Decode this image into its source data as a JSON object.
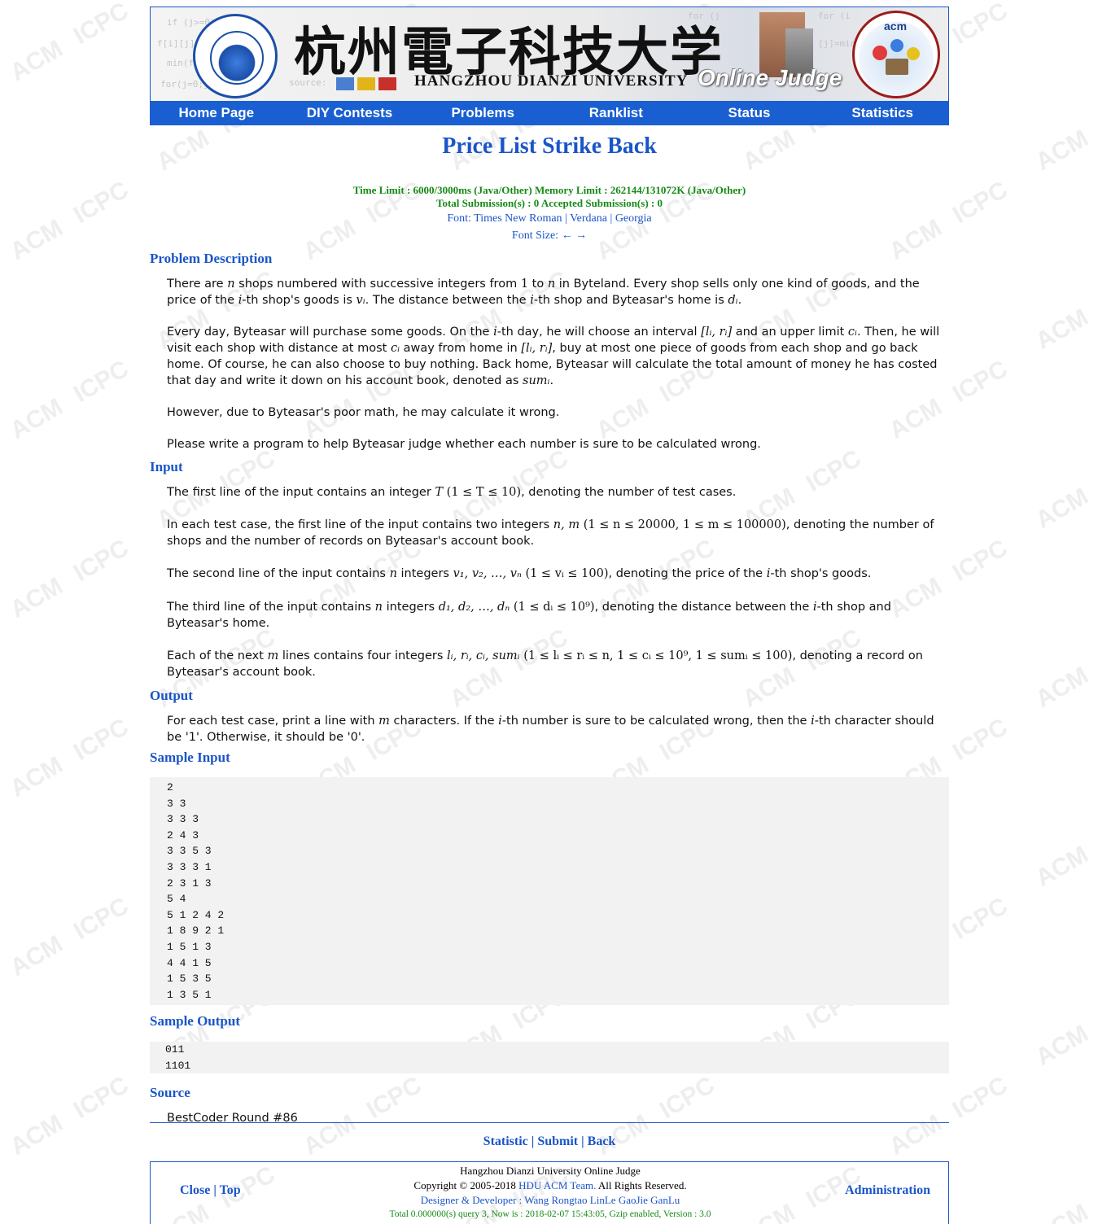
{
  "watermark": {
    "word1": "ACM",
    "word2": "ICPC"
  },
  "header": {
    "logo_left_alt": "Hangzhou Dianzi University seal",
    "chinese_name": "杭州電子科技大学",
    "english_name": "HANGZHOU DIANZI UNIVERSITY",
    "oj_label": "Online Judge",
    "logo_right_text": "acm",
    "logo_right_ring": "International Collegiate Programming Contest"
  },
  "nav": {
    "items": [
      "Home Page",
      "DIY Contests",
      "Problems",
      "Ranklist",
      "Status",
      "Statistics"
    ]
  },
  "problem": {
    "title": "Price List Strike Back",
    "limits_line1": "Time Limit : 6000/3000ms (Java/Other)   Memory Limit : 262144/131072K (Java/Other)",
    "limits_line2": "Total Submission(s) : 0   Accepted Submission(s) : 0",
    "font_label": "Font:",
    "fonts": [
      "Times New Roman",
      "Verdana",
      "Georgia"
    ],
    "font_size_label": "Font Size:",
    "font_size_arrows": "← →"
  },
  "sections": {
    "description_title": "Problem Description",
    "input_title": "Input",
    "output_title": "Output",
    "sample_input_title": "Sample Input",
    "sample_output_title": "Sample Output",
    "source_title": "Source"
  },
  "description": {
    "p1a": "There are ",
    "p1_n": "n",
    "p1b": " shops numbered with successive integers from ",
    "p1_1": "1",
    "p1c": " to ",
    "p1_n2": "n",
    "p1d": " in Byteland. Every shop sells only one kind of goods, and the price of the ",
    "p1_i": "i",
    "p1e": "-th shop's goods is ",
    "p1_vi": "vᵢ",
    "p1f": ". The distance between the ",
    "p1_i2": "i",
    "p1g": "-th shop and Byteasar's home is ",
    "p1_di": "dᵢ",
    "p1h": ".",
    "p2a": "Every day, Byteasar will purchase some goods. On the ",
    "p2_i": "i",
    "p2b": "-th day, he will choose an interval ",
    "p2_lr": "[lᵢ, rᵢ]",
    "p2c": " and an upper limit ",
    "p2_ci": "cᵢ",
    "p2d": ". Then, he will visit each shop with distance at most ",
    "p2_ci2": "cᵢ",
    "p2e": " away from home in ",
    "p2_lr2": "[lᵢ, rᵢ]",
    "p2f": ", buy at most one piece of goods from each shop and go back home. Of course, he can also choose to buy nothing. Back home, Byteasar will calculate the total amount of money he has costed that day and write it down on his account book, denoted as ",
    "p2_sum": "sumᵢ",
    "p2g": ".",
    "p3": "However, due to Byteasar's poor math, he may calculate it wrong.",
    "p4": "Please write a program to help Byteasar judge whether each number is sure to be calculated wrong."
  },
  "input": {
    "l1a": "The first line of the input contains an integer ",
    "l1_T": "T",
    "l1_cond": "(1 ≤ T ≤ 10)",
    "l1b": ", denoting the number of test cases.",
    "l2a": "In each test case, the first line of the input contains two integers ",
    "l2_nm": "n, m",
    "l2_cond": "(1 ≤ n ≤ 20000, 1 ≤ m ≤ 100000)",
    "l2b": ", denoting the number of shops and the number of records on Byteasar's account book.",
    "l3a": "The second line of the input contains ",
    "l3_n": "n",
    "l3b": " integers ",
    "l3_v": "v₁, v₂, …, vₙ",
    "l3_cond": "(1 ≤ vᵢ ≤ 100)",
    "l3c": ", denoting the price of the ",
    "l3_i": "i",
    "l3d": "-th shop's goods.",
    "l4a": "The third line of the input contains ",
    "l4_n": "n",
    "l4b": " integers ",
    "l4_d": "d₁, d₂, …, dₙ",
    "l4_cond": "(1 ≤ dᵢ ≤ 10⁹)",
    "l4c": ", denoting the distance between the ",
    "l4_i": "i",
    "l4d": "-th shop and Byteasar's home.",
    "l5a": "Each of the next ",
    "l5_m": "m",
    "l5b": " lines contains four integers ",
    "l5_vars": "lᵢ, rᵢ, cᵢ, sumᵢ",
    "l5_cond": "(1 ≤ lᵢ ≤ rᵢ ≤ n, 1 ≤ cᵢ ≤ 10⁹, 1 ≤ sumᵢ ≤ 100)",
    "l5c": ", denoting a record on Byteasar's account book."
  },
  "output": {
    "a": "For each test case, print a line with ",
    "m": "m",
    "b": " characters. If the ",
    "i": "i",
    "c": "-th number is sure to be calculated wrong, then the ",
    "i2": "i",
    "d": "-th character should be '1'. Otherwise, it should be '0'."
  },
  "sample_input": [
    "2",
    "3 3",
    "3 3 3",
    "2 4 3",
    "3 3 5 3",
    "3 3 3 1",
    "2 3 1 3",
    "5 4",
    "5 1 2 4 2",
    "1 8 9 2 1",
    "1 5 1 3",
    "4 4 1 5",
    "1 5 3 5",
    "1 3 5 1"
  ],
  "sample_output": [
    "011",
    "1101"
  ],
  "source": "BestCoder Round #86",
  "bottom_links": {
    "statistic": "Statistic",
    "submit": "Submit",
    "back": "Back"
  },
  "footer": {
    "close": "Close",
    "top": "Top",
    "admin": "Administration",
    "line1": "Hangzhou Dianzi University Online Judge",
    "copy_a": "Copyright © 2005-2018 ",
    "copy_link": "HDU ACM Team.",
    "copy_b": " All Rights Reserved.",
    "designer": "Designer & Developer : Wang Rongtao LinLe GaoJie GanLu",
    "stats": "Total 0.000000(s) query 3, Now is : 2018-02-07 15:43:05, Gzip enabled, Version : 3.0"
  },
  "colors": {
    "brand_blue": "#1a55c8",
    "nav_blue": "#1a5fd1",
    "limit_green": "#158a15",
    "code_bg": "#f2f2f2"
  }
}
